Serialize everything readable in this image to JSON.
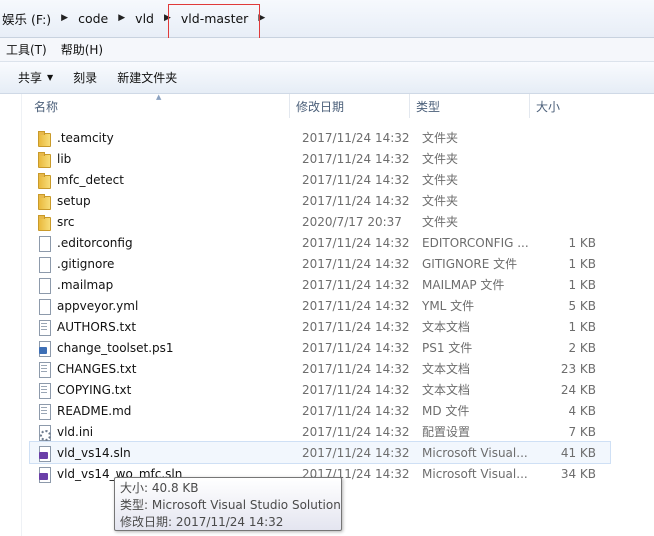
{
  "address": {
    "crumbs": [
      "娱乐 (F:)",
      "code",
      "vld",
      "vld-master"
    ]
  },
  "menu": [
    "工具(T)",
    "帮助(H)"
  ],
  "toolbar": {
    "share": "共享",
    "burn": "刻录",
    "new_folder": "新建文件夹"
  },
  "columns": {
    "name": "名称",
    "date": "修改日期",
    "type": "类型",
    "size": "大小"
  },
  "files": [
    {
      "icon": "folder-icon",
      "name": ".teamcity",
      "date": "2017/11/24 14:32",
      "type": "文件夹",
      "size": ""
    },
    {
      "icon": "folder-icon",
      "name": "lib",
      "date": "2017/11/24 14:32",
      "type": "文件夹",
      "size": ""
    },
    {
      "icon": "folder-icon",
      "name": "mfc_detect",
      "date": "2017/11/24 14:32",
      "type": "文件夹",
      "size": ""
    },
    {
      "icon": "folder-icon",
      "name": "setup",
      "date": "2017/11/24 14:32",
      "type": "文件夹",
      "size": ""
    },
    {
      "icon": "folder-icon",
      "name": "src",
      "date": "2020/7/17 20:37",
      "type": "文件夹",
      "size": ""
    },
    {
      "icon": "file-icon",
      "name": ".editorconfig",
      "date": "2017/11/24 14:32",
      "type": "EDITORCONFIG ...",
      "size": "1 KB"
    },
    {
      "icon": "file-icon",
      "name": ".gitignore",
      "date": "2017/11/24 14:32",
      "type": "GITIGNORE 文件",
      "size": "1 KB"
    },
    {
      "icon": "file-icon",
      "name": ".mailmap",
      "date": "2017/11/24 14:32",
      "type": "MAILMAP 文件",
      "size": "1 KB"
    },
    {
      "icon": "file-icon",
      "name": "appveyor.yml",
      "date": "2017/11/24 14:32",
      "type": "YML 文件",
      "size": "5 KB"
    },
    {
      "icon": "text-file-icon",
      "name": "AUTHORS.txt",
      "date": "2017/11/24 14:32",
      "type": "文本文档",
      "size": "1 KB"
    },
    {
      "icon": "powershell-file-icon",
      "name": "change_toolset.ps1",
      "date": "2017/11/24 14:32",
      "type": "PS1 文件",
      "size": "2 KB"
    },
    {
      "icon": "text-file-icon",
      "name": "CHANGES.txt",
      "date": "2017/11/24 14:32",
      "type": "文本文档",
      "size": "23 KB"
    },
    {
      "icon": "text-file-icon",
      "name": "COPYING.txt",
      "date": "2017/11/24 14:32",
      "type": "文本文档",
      "size": "24 KB"
    },
    {
      "icon": "text-file-icon",
      "name": "README.md",
      "date": "2017/11/24 14:32",
      "type": "MD 文件",
      "size": "4 KB"
    },
    {
      "icon": "settings-file-icon",
      "name": "vld.ini",
      "date": "2017/11/24 14:32",
      "type": "配置设置",
      "size": "7 KB"
    },
    {
      "icon": "solution-file-icon",
      "name": "vld_vs14.sln",
      "date": "2017/11/24 14:32",
      "type": "Microsoft Visual...",
      "size": "41 KB"
    },
    {
      "icon": "solution-file-icon",
      "name": "vld_vs14_wo_mfc.sln",
      "date": "2017/11/24 14:32",
      "type": "Microsoft Visual...",
      "size": "34 KB"
    }
  ],
  "tooltip": {
    "size": "大小: 40.8 KB",
    "type": "类型: Microsoft Visual Studio Solution",
    "modified": "修改日期: 2017/11/24 14:32"
  }
}
